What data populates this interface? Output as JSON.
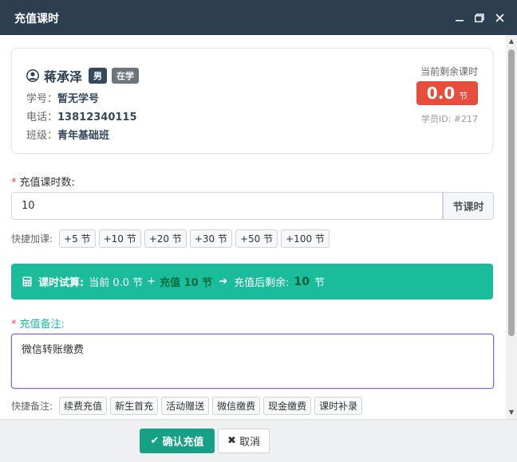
{
  "window": {
    "title": "充值课时"
  },
  "student": {
    "name": "蒋承泽",
    "gender": "男",
    "status": "在学",
    "student_no_label": "学号：",
    "student_no": "暂无学号",
    "phone_label": "电话：",
    "phone": "13812340115",
    "class_label": "班级：",
    "class": "青年基础班",
    "remain_label": "当前剩余课时",
    "remain_value": "0.0",
    "remain_unit": "节",
    "student_id": "学员ID: #217"
  },
  "recharge": {
    "required_mark": "*",
    "hours_label": "充值课时数:",
    "hours_value": "10",
    "hours_suffix": "节课时",
    "quick_add_label": "快捷加课:",
    "quick_add_options": [
      "+5 节",
      "+10 节",
      "+20 节",
      "+30 节",
      "+50 节",
      "+100 节"
    ]
  },
  "calc": {
    "title": "课时试算:",
    "current": "当前 0.0 节",
    "plus": "+",
    "recharge": "充值 10 节",
    "arrow": "➔",
    "after_label": "充值后剩余:",
    "after_value": "10",
    "after_unit": "节"
  },
  "note": {
    "required_mark": "*",
    "label": "充值备注:",
    "value": "微信转账缴费",
    "quick_label": "快捷备注:",
    "quick_options": [
      "续费充值",
      "新生首充",
      "活动赠送",
      "微信缴费",
      "现金缴费",
      "课时补录"
    ]
  },
  "footer": {
    "confirm_label": "确认充值",
    "cancel_label": "取消"
  },
  "colors": {
    "titlebar": "#2c3e50",
    "accent": "#1abc9c",
    "danger": "#e74c3c",
    "confirm": "#16a085"
  }
}
